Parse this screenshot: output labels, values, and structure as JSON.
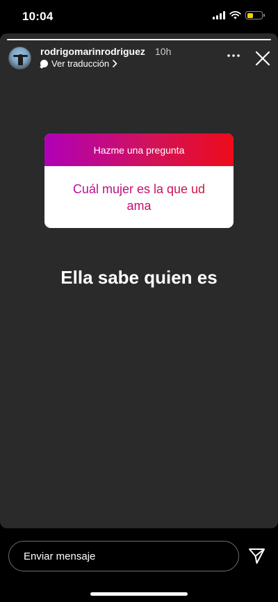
{
  "status_bar": {
    "time": "10:04",
    "battery_level": 0.4,
    "battery_color": "#f4d000",
    "icons": [
      "cellular-signal-icon",
      "wifi-icon",
      "battery-icon"
    ]
  },
  "story": {
    "progress": 1.0,
    "background_color": "#2a2a2a",
    "header": {
      "username": "rodrigomarinrodriguez",
      "time_ago": "10h",
      "translate_label": "Ver traducción",
      "icons": [
        "avatar",
        "speech-bubble-icon",
        "chevron-right-icon",
        "more-options-icon",
        "close-icon"
      ]
    },
    "sticker": {
      "title": "Hazme una pregunta",
      "question": "Cuál mujer es la que ud ama",
      "gradient_colors": [
        "#b000b8",
        "#d0125c",
        "#ee0b1a"
      ]
    },
    "caption": "Ella sabe quien es"
  },
  "reply": {
    "placeholder": "Enviar mensaje",
    "send_icon": "send-paper-plane-icon"
  }
}
